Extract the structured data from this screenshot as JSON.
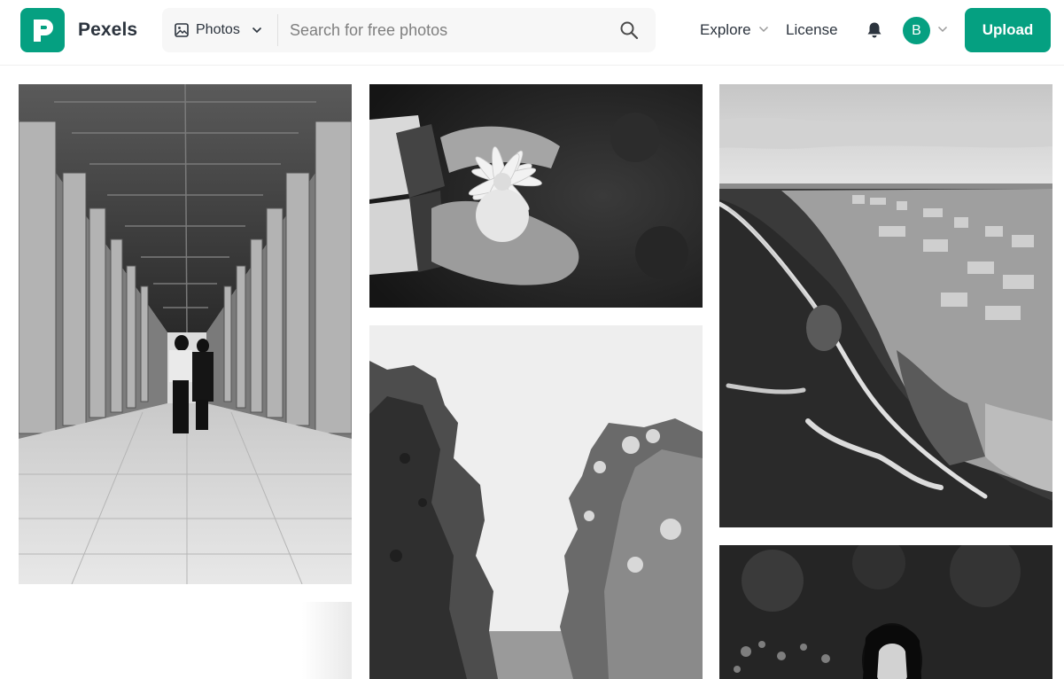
{
  "brand": {
    "name": "Pexels",
    "color": "#05a081"
  },
  "search": {
    "type_label": "Photos",
    "placeholder": "Search for free photos",
    "value": ""
  },
  "nav": {
    "explore": "Explore",
    "license": "License"
  },
  "user": {
    "initial": "B"
  },
  "upload_label": "Upload",
  "icons": {
    "logo": "pexels-logo-icon",
    "photo_type": "image-icon",
    "search": "search-icon",
    "notifications": "bell-icon",
    "dropdown": "chevron-down-icon"
  },
  "photos": [
    {
      "subject": "colonnade-corridor"
    },
    {
      "subject": "hands-holding-flower"
    },
    {
      "subject": "sea-rocks"
    },
    {
      "subject": "coastal-town-aerial"
    },
    {
      "subject": "woman-in-forest"
    },
    {
      "subject": "partial-tile"
    }
  ]
}
